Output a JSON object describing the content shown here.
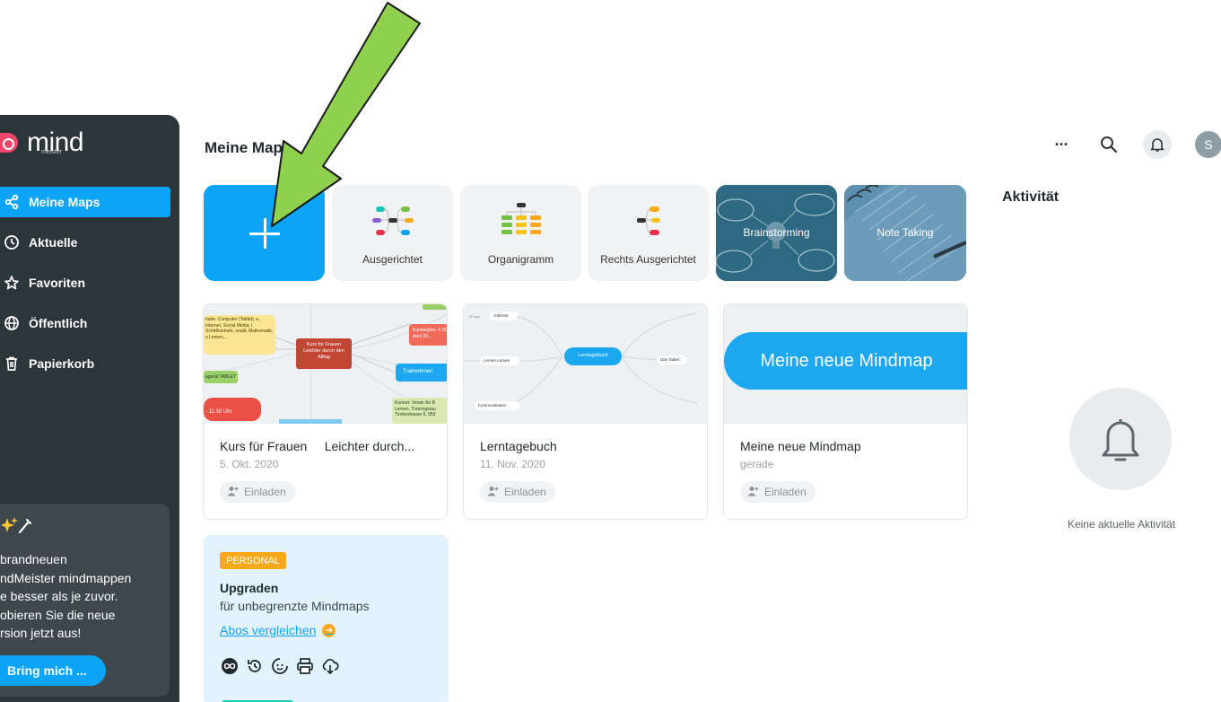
{
  "brand": {
    "name": "mind",
    "sub": "meister",
    "accent": "#0ca4f5",
    "logo_color": "#f0466b"
  },
  "sidebar": {
    "items": [
      {
        "label": "Meine Maps",
        "icon": "share-nodes-icon",
        "active": true
      },
      {
        "label": "Aktuelle",
        "icon": "clock-icon",
        "active": false
      },
      {
        "label": "Favoriten",
        "icon": "star-icon",
        "active": false
      },
      {
        "label": "Öffentlich",
        "icon": "globe-icon",
        "active": false
      },
      {
        "label": "Papierkorb",
        "icon": "trash-icon",
        "active": false
      }
    ],
    "promo": {
      "icon": "sparkle-wand-icon",
      "text": "brandneuen\nndMeister mindmappen\ne besser als je zuvor.\nobieren Sie die neue\nrsion jetzt aus!",
      "button_label": "Bring mich ..."
    }
  },
  "header": {
    "title": "Meine Maps",
    "more_label": "···",
    "search_icon": "search-icon",
    "bell_icon": "bell-icon",
    "avatar_initial": "S"
  },
  "templates": [
    {
      "label": "",
      "kind": "new",
      "icon": "plus-icon"
    },
    {
      "label": "Ausgerichtet",
      "kind": "template"
    },
    {
      "label": "Organigramm",
      "kind": "template"
    },
    {
      "label": "Rechts Ausgerichtet",
      "kind": "template"
    },
    {
      "label": "Brainstorming",
      "kind": "photo"
    },
    {
      "label": "Note Taking",
      "kind": "photo"
    }
  ],
  "maps": [
    {
      "title": "Kurs für Frauen     Leichter durch...",
      "date": "5. Okt. 2020",
      "invite_label": "Einladen",
      "thumb": {
        "center": "Kurs für Frauen Leichter durch den Alltag",
        "node_yellow": "halte: Computer (Tablet), e, Internet, Social Media, l, Schriftverkehr, onalit, Mathematik, n Lernen,...",
        "node_red_right": "Kursbeginn: 4 29. April 20...",
        "node_blue": "Trainerinnen",
        "node_green_left": "agerät TABLET",
        "node_red_left": "- 11:30 Uhr",
        "node_green_right": "Kursort: Verein für B Lernen, Trainingsrau Tirolerstrasse 6, 950"
      }
    },
    {
      "title": "Lerntagebuch",
      "date": "11. Nov. 2020",
      "invite_label": "Einladen",
      "thumb": {
        "center": "Lerntagebuch",
        "n1": "Internet",
        "n2": "Lernen Lernen",
        "n3": "Kommunikation",
        "n4": "Das Tablet",
        "n5": "W Lan"
      }
    },
    {
      "title": "Meine neue Mindmap",
      "date": "gerade",
      "invite_label": "Einladen",
      "thumb": {
        "center": "Meine neue Mindmap"
      }
    }
  ],
  "upgrade": {
    "badge": "PERSONAL",
    "title": "Upgraden",
    "subtitle": "für unbegrenzte Mindmaps",
    "link": "Abos vergleichen",
    "icons": [
      "infinity-icon",
      "history-icon",
      "emoji-icon",
      "printer-icon",
      "cloud-download-icon"
    ]
  },
  "activity": {
    "title": "Aktivität",
    "empty_text": "Keine aktuelle Aktivität"
  },
  "annotation": {
    "arrow_color": "#8fd14f"
  }
}
